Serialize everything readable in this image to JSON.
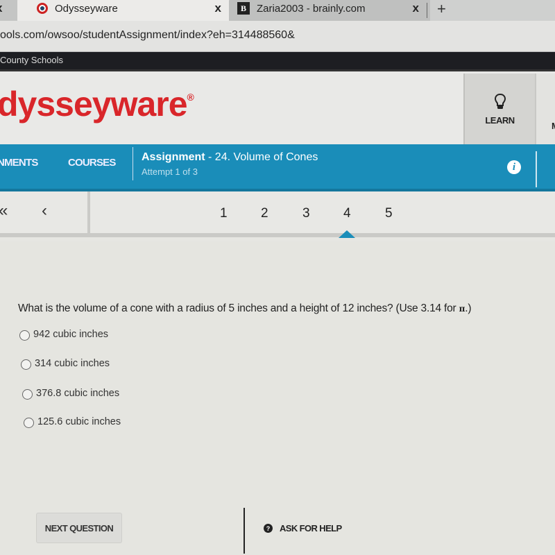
{
  "browser": {
    "tabs": [
      {
        "title": "",
        "close": "x"
      },
      {
        "title": "Odysseyware",
        "close": "x",
        "active": true
      },
      {
        "title": "Zaria2003 - brainly.com",
        "favicon": "B",
        "close": "x"
      }
    ],
    "new_tab": "+",
    "url": "ools.com/owsoo/studentAssignment/index?eh=314488560&"
  },
  "district": "County Schools",
  "header": {
    "logo": "dysseyware",
    "logo_mark": "®",
    "learn_label": "LEARN",
    "next_label": "M"
  },
  "nav": {
    "items": [
      "NMENTS",
      "COURSES"
    ],
    "assignment_label": "Assignment",
    "assignment_name": " - 24. Volume of Cones",
    "attempt": "Attempt 1 of 3",
    "info_glyph": "i",
    "accent_color": "#1a8db9"
  },
  "pager": {
    "first_glyph": "«",
    "prev_glyph": "‹",
    "questions": [
      "1",
      "2",
      "3",
      "4",
      "5"
    ],
    "current": "4"
  },
  "question": {
    "text": "What is the volume of a cone with a radius of 5 inches and a height of 12 inches? (Use 3.14 for ",
    "pi": "π",
    "tail": ".)",
    "options": [
      "942 cubic inches",
      "314 cubic inches",
      "376.8 cubic inches",
      "125.6 cubic inches"
    ]
  },
  "footer": {
    "next_label": "NEXT QUESTION",
    "help_label": "ASK FOR HELP",
    "help_glyph": "?"
  }
}
